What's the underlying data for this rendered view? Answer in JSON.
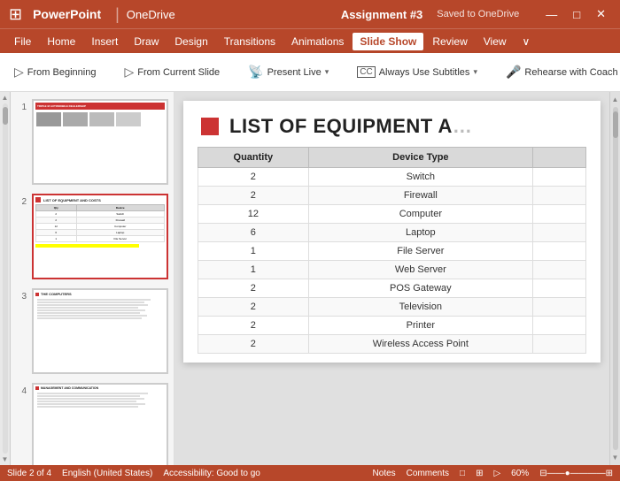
{
  "titleBar": {
    "appName": "PowerPoint",
    "separator": "|",
    "driveName": "OneDrive",
    "filename": "Assignment #3",
    "savedStatus": "Saved to OneDrive",
    "controls": [
      "—",
      "□",
      "✕"
    ]
  },
  "menuBar": {
    "items": [
      "File",
      "Home",
      "Insert",
      "Draw",
      "Design",
      "Transitions",
      "Animations",
      "Slide Show",
      "Review",
      "View",
      "∨"
    ],
    "activeItem": "Slide Show"
  },
  "ribbon": {
    "buttons": [
      {
        "id": "from-beginning",
        "label": "From Beginning",
        "icon": "▷"
      },
      {
        "id": "from-current",
        "label": "From Current Slide",
        "icon": "▷"
      },
      {
        "id": "present-live",
        "label": "Present Live",
        "icon": "📡",
        "dropdown": true
      },
      {
        "id": "always-subtitles",
        "label": "Always Use Subtitles",
        "icon": "CC",
        "dropdown": true
      },
      {
        "id": "rehearse-coach",
        "label": "Rehearse with Coach",
        "icon": "🎤"
      }
    ]
  },
  "slidesPanel": {
    "slides": [
      {
        "num": "1",
        "title": "TRIPLE M AUTOMOBILE DEALERSHIP"
      },
      {
        "num": "2",
        "title": "LIST OF EQUIPMENT AND COSTS",
        "active": true
      },
      {
        "num": "3",
        "title": "THE COMPUTERS"
      },
      {
        "num": "4",
        "title": "MANAGEMENT AND COMMUNICATION"
      }
    ]
  },
  "mainSlide": {
    "titlePrefix": "LIST OF EQUIPMENT A",
    "table": {
      "headers": [
        "Quantity",
        "Device Type",
        ""
      ],
      "rows": [
        [
          "2",
          "Switch"
        ],
        [
          "2",
          "Firewall"
        ],
        [
          "12",
          "Computer"
        ],
        [
          "6",
          "Laptop"
        ],
        [
          "1",
          "File Server"
        ],
        [
          "1",
          "Web Server"
        ],
        [
          "2",
          "POS Gateway"
        ],
        [
          "2",
          "Television"
        ],
        [
          "2",
          "Printer"
        ],
        [
          "2",
          "Wireless Access Point"
        ]
      ]
    }
  },
  "statusBar": {
    "slideInfo": "Slide 2 of 4",
    "language": "English (United States)",
    "accessibility": "Accessibility: Good to go",
    "zoomLabel": "Notes",
    "viewIcons": [
      "□",
      "□",
      "□"
    ],
    "zoomPercent": "60%"
  },
  "colors": {
    "accent": "#C33",
    "titleBarBg": "#B7472A",
    "activeTab": "white"
  }
}
